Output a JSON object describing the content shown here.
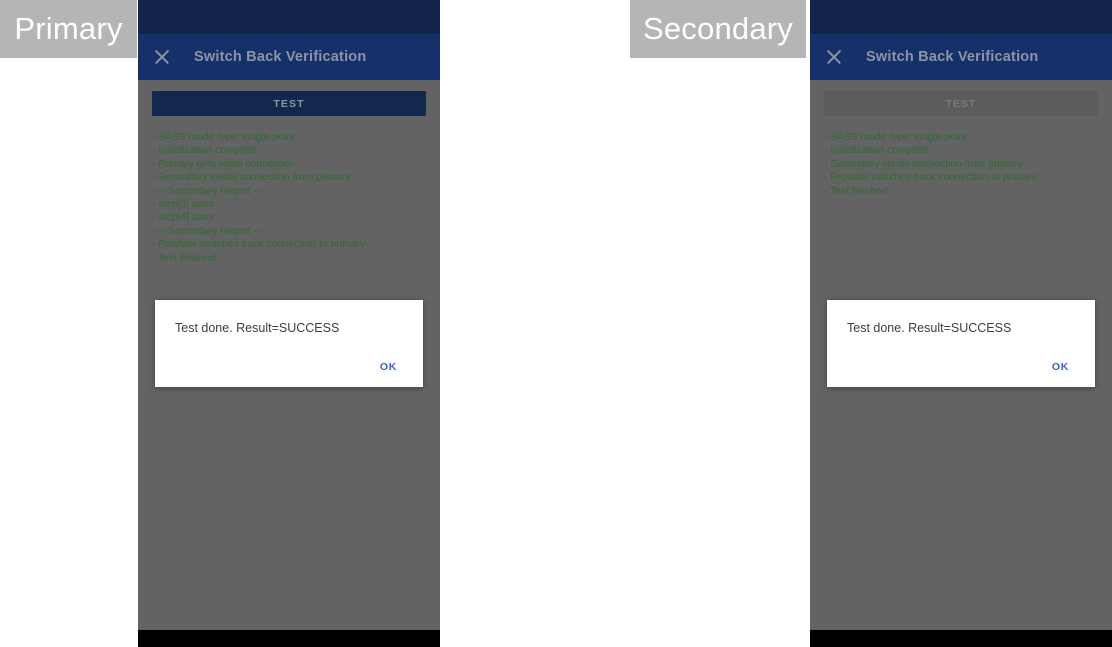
{
  "labels": {
    "primary": "Primary",
    "secondary": "Secondary"
  },
  "colors": {
    "status_bar": "#13244a",
    "toolbar": "#15306b",
    "scrim": "#636363",
    "button_enabled": "#12284f",
    "button_disabled": "#5c5c5c",
    "log_text": "#2f6b2f",
    "dialog_action": "#3b63c8",
    "label_background": "#b5b5b5",
    "nav_bar": "#000000"
  },
  "devices": [
    {
      "role": "primary",
      "toolbar": {
        "close_icon": "close-icon",
        "title": "Switch Back Verification"
      },
      "test_button": {
        "label": "TEST",
        "state": "enabled"
      },
      "log_lines": [
        "- SASS mode type: single-point",
        "- Initialization complete",
        "- Primary gets initial connection",
        "- Secondary steals connection from primary",
        "- -- Secondary Report --",
        "- step[3] pass",
        "- step[4] pass",
        "- -- Secondary Report --",
        "- Provider switches back connection to primary",
        "- Test finished"
      ],
      "dialog": {
        "message": "Test done. Result=SUCCESS",
        "ok_label": "OK"
      }
    },
    {
      "role": "secondary",
      "toolbar": {
        "close_icon": "close-icon",
        "title": "Switch Back Verification"
      },
      "test_button": {
        "label": "TEST",
        "state": "disabled"
      },
      "log_lines": [
        "- SASS mode type: single-point",
        "- Initialization complete",
        "- Secondary steals connection from primary",
        "- Provider switches back connection to primary",
        "- Test finished"
      ],
      "dialog": {
        "message": "Test done. Result=SUCCESS",
        "ok_label": "OK"
      }
    }
  ]
}
